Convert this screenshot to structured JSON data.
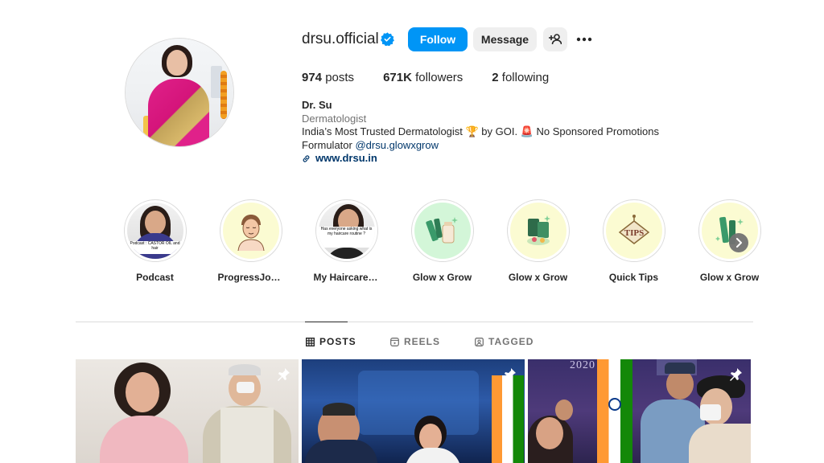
{
  "profile": {
    "username": "drsu.official",
    "follow_label": "Follow",
    "message_label": "Message",
    "posts_count": "974",
    "posts_label": "posts",
    "followers_count": "671K",
    "followers_label": "followers",
    "following_count": "2",
    "following_label": "following",
    "name": "Dr. Su",
    "category": "Dermatologist",
    "bio_line1": "India’s Most Trusted Dermatologist 🏆 by GOI. 🚨 No Sponsored Promotions",
    "bio_line2_prefix": "Formulator",
    "bio_mention": "@drsu.glowxgrow",
    "website": "www.drsu.in"
  },
  "highlights": [
    {
      "label": "Podcast",
      "icon": "photo"
    },
    {
      "label": "ProgressJour...",
      "icon": "face-sketch"
    },
    {
      "label": "My Haircare💜",
      "icon": "photo"
    },
    {
      "label": "Glow x Grow",
      "icon": "products"
    },
    {
      "label": "Glow x Grow",
      "icon": "products"
    },
    {
      "label": "Quick Tips",
      "icon": "tips-sign"
    },
    {
      "label": "Glow x Grow",
      "icon": "products"
    }
  ],
  "highlight_caption_podcast": "Podcast : CASTOR OIL and hair",
  "highlight_caption_haircare": "Has everyone asking what is my haircare routine ?",
  "tips_sign_text": "TIPS",
  "tabs": [
    {
      "label": "POSTS",
      "active": true
    },
    {
      "label": "REELS",
      "active": false
    },
    {
      "label": "TAGGED",
      "active": false
    }
  ],
  "post_year": "2020",
  "colors": {
    "accent": "#0095f6",
    "verified": "#0095f6",
    "link": "#00376b",
    "secondary_text": "#737373"
  }
}
